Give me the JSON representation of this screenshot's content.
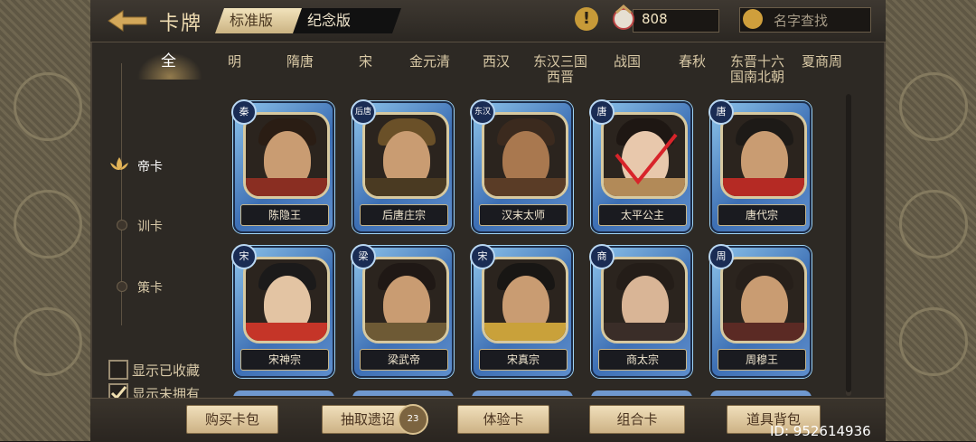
{
  "header": {
    "title": "卡牌",
    "version_tabs": [
      "标准版",
      "纪念版"
    ],
    "currency_value": "808",
    "search_placeholder": "名字查找"
  },
  "dynasties": [
    "全",
    "明",
    "隋唐",
    "宋",
    "金元清",
    "西汉",
    "东汉三国\n西晋",
    "战国",
    "春秋",
    "东晋十六\n国南北朝",
    "夏商周"
  ],
  "categories": [
    "帝卡",
    "训卡",
    "策卡"
  ],
  "filters": [
    "显示已收藏",
    "显示未拥有"
  ],
  "cards": [
    {
      "badge": "秦",
      "name": "陈隐王"
    },
    {
      "badge": "后唐",
      "name": "后唐庄宗"
    },
    {
      "badge": "东汉",
      "name": "汉末太师"
    },
    {
      "badge": "唐",
      "name": "太平公主"
    },
    {
      "badge": "唐",
      "name": "唐代宗"
    },
    {
      "badge": "宋",
      "name": "宋神宗"
    },
    {
      "badge": "梁",
      "name": "梁武帝"
    },
    {
      "badge": "宋",
      "name": "宋真宗"
    },
    {
      "badge": "商",
      "name": "商太宗"
    },
    {
      "badge": "周",
      "name": "周穆王"
    }
  ],
  "bottom_buttons": [
    "购买卡包",
    "抽取遗诏",
    "体验卡",
    "组合卡",
    "道具背包"
  ],
  "draw_badge": "23",
  "id_text": "ID: 952614936"
}
